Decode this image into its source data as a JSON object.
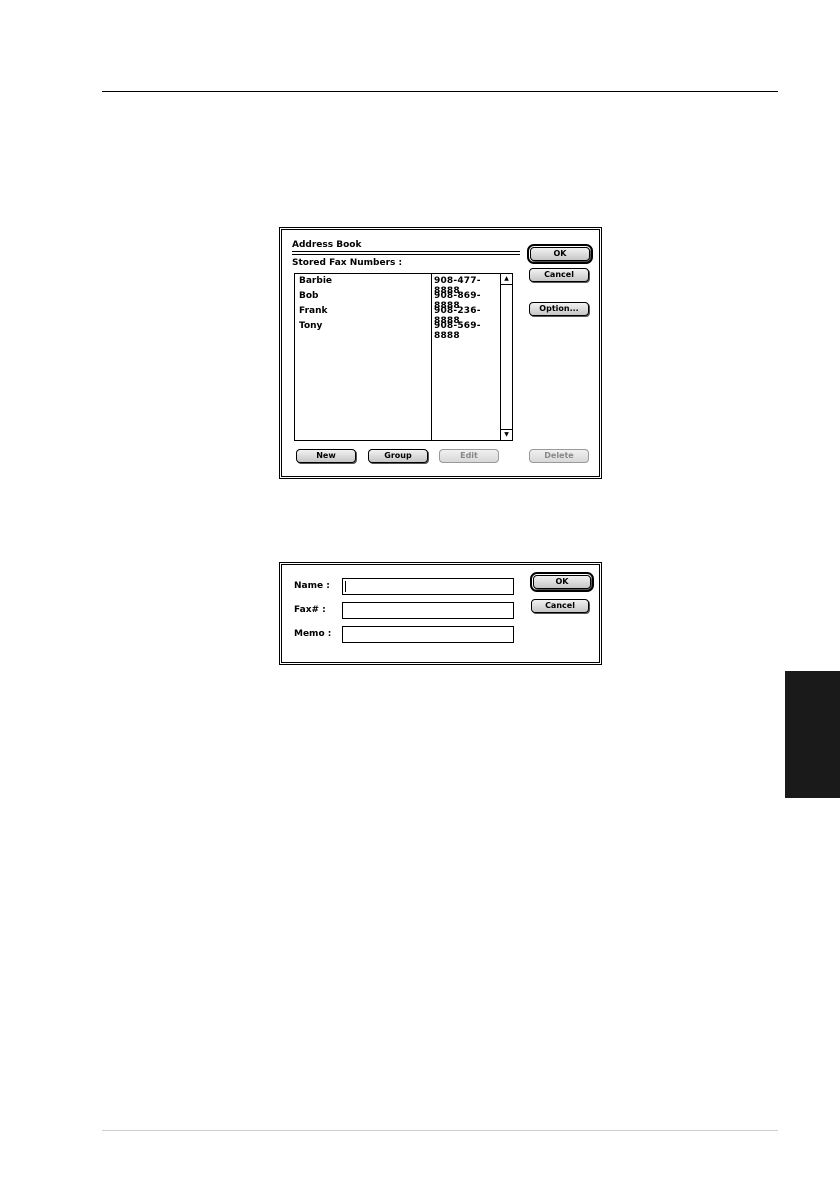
{
  "address_book": {
    "title": "Address Book",
    "list_label": "Stored Fax Numbers :",
    "entries": [
      {
        "name": "Barbie",
        "fax": "908-477-8888"
      },
      {
        "name": "Bob",
        "fax": "908-869-8888"
      },
      {
        "name": "Frank",
        "fax": "908-236-8888"
      },
      {
        "name": "Tony",
        "fax": "908-569-8888"
      }
    ],
    "buttons": {
      "ok": "OK",
      "cancel": "Cancel",
      "option": "Option...",
      "new": "New",
      "group": "Group",
      "edit": "Edit",
      "delete": "Delete"
    }
  },
  "entry_dialog": {
    "name_label": "Name :",
    "fax_label": "Fax# :",
    "memo_label": "Memo :",
    "name_value": "",
    "fax_value": "",
    "memo_value": "",
    "buttons": {
      "ok": "OK",
      "cancel": "Cancel"
    }
  }
}
